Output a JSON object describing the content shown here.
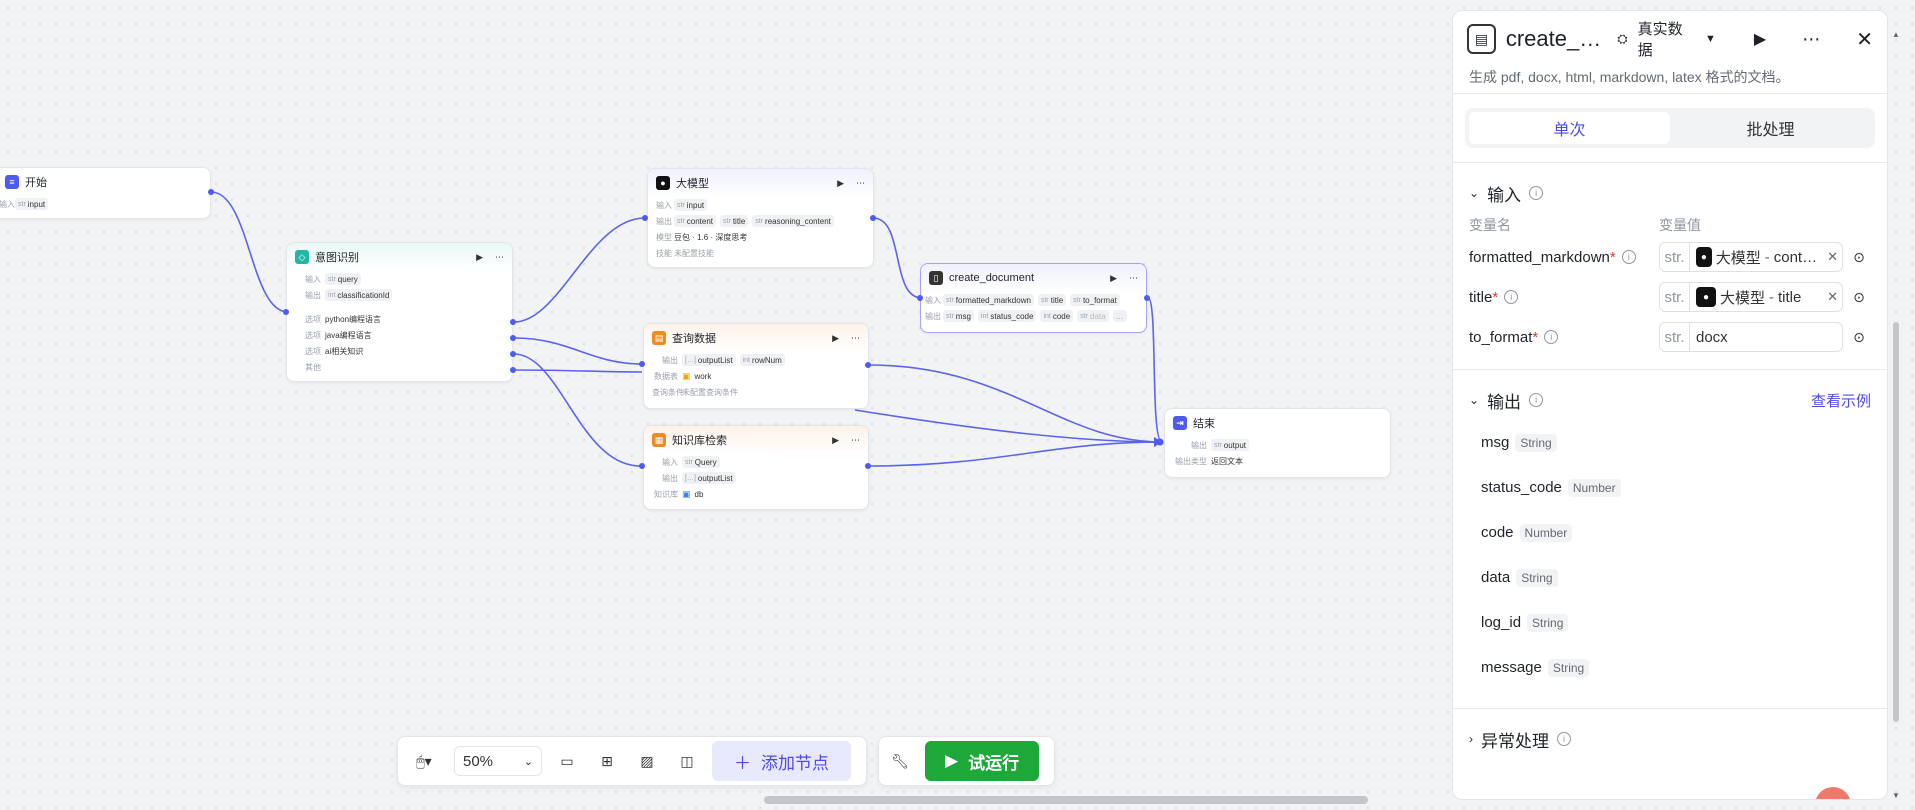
{
  "nodes": {
    "start": {
      "title": "开始",
      "in_label": "输入",
      "in_tag_type": "str",
      "in_tag": "input"
    },
    "intent": {
      "title": "意图识别",
      "in_label": "输入",
      "in_type": "str",
      "in_tag": "query",
      "out_label": "输出",
      "out_type": "int",
      "out_tag": "classificationId",
      "options": [
        {
          "label": "选项",
          "text": "python编程语言"
        },
        {
          "label": "选项",
          "text": "java编程语言"
        },
        {
          "label": "选项",
          "text": "ai相关知识"
        },
        {
          "label": "其他",
          "text": ""
        }
      ]
    },
    "llm": {
      "title": "大模型",
      "in_label": "输入",
      "in_type": "str",
      "in_tag": "input",
      "out_label": "输出",
      "outputs": [
        {
          "t": "str",
          "n": "content"
        },
        {
          "t": "str",
          "n": "title"
        },
        {
          "t": "str",
          "n": "reasoning_content"
        }
      ],
      "model_label": "模型",
      "model_value": "豆包 · 1.6 · 深度思考",
      "skill_label": "技能",
      "skill_value": "未配置技能"
    },
    "query": {
      "title": "查询数据",
      "out_label": "输出",
      "out_tags": [
        {
          "t": "[…]",
          "n": "outputList"
        },
        {
          "t": "int",
          "n": "rowNum"
        }
      ],
      "table_label": "数据表",
      "table_value": "work",
      "cond_label": "查询条件",
      "cond_value": "未配置查询条件"
    },
    "kb": {
      "title": "知识库检索",
      "in_label": "输入",
      "in_type": "str",
      "in_tag": "Query",
      "out_label": "输出",
      "out_type": "[…]",
      "out_tag": "outputList",
      "kb_label": "知识库",
      "kb_value": "db"
    },
    "doc": {
      "title": "create_document",
      "in_label": "输入",
      "inputs": [
        {
          "t": "str",
          "n": "formatted_markdown"
        },
        {
          "t": "str",
          "n": "title"
        },
        {
          "t": "str",
          "n": "to_format"
        }
      ],
      "out_label": "输出",
      "outputs": [
        {
          "t": "str",
          "n": "msg"
        },
        {
          "t": "int",
          "n": "status_code"
        },
        {
          "t": "int",
          "n": "code"
        },
        {
          "t": "str",
          "n": "data"
        },
        {
          "t": "",
          "n": "…"
        }
      ]
    },
    "end": {
      "title": "结束",
      "out_label": "输出",
      "out_type": "str",
      "out_tag": "output",
      "type_label": "输出类型",
      "type_value": "返回文本"
    }
  },
  "toolbar": {
    "zoom": "50%",
    "add_node": "添加节点",
    "run": "试运行"
  },
  "panel": {
    "title": "create_…",
    "data_mode": "真实数据",
    "description": "生成 pdf, docx, html, markdown, latex 格式的文档。",
    "tabs": [
      "单次",
      "批处理"
    ],
    "input_section": "输入",
    "col_name": "变量名",
    "col_value": "变量值",
    "inputs": [
      {
        "name": "formatted_markdown",
        "required": "*",
        "type": "str.",
        "source": "大模型",
        "sep": "-",
        "field": "cont…"
      },
      {
        "name": "title",
        "required": "*",
        "type": "str.",
        "source": "大模型",
        "sep": "-",
        "field": "title"
      },
      {
        "name": "to_format",
        "required": "*",
        "type": "str.",
        "value": "docx"
      }
    ],
    "output_section": "输出",
    "view_example": "查看示例",
    "outputs": [
      {
        "name": "msg",
        "type": "String"
      },
      {
        "name": "status_code",
        "type": "Number"
      },
      {
        "name": "code",
        "type": "Number"
      },
      {
        "name": "data",
        "type": "String"
      },
      {
        "name": "log_id",
        "type": "String"
      },
      {
        "name": "message",
        "type": "String"
      }
    ],
    "error_section": "异常处理"
  },
  "colors": {
    "accent": "#4e49e8",
    "run": "#1fa83a",
    "edge": "#5b63ef"
  }
}
